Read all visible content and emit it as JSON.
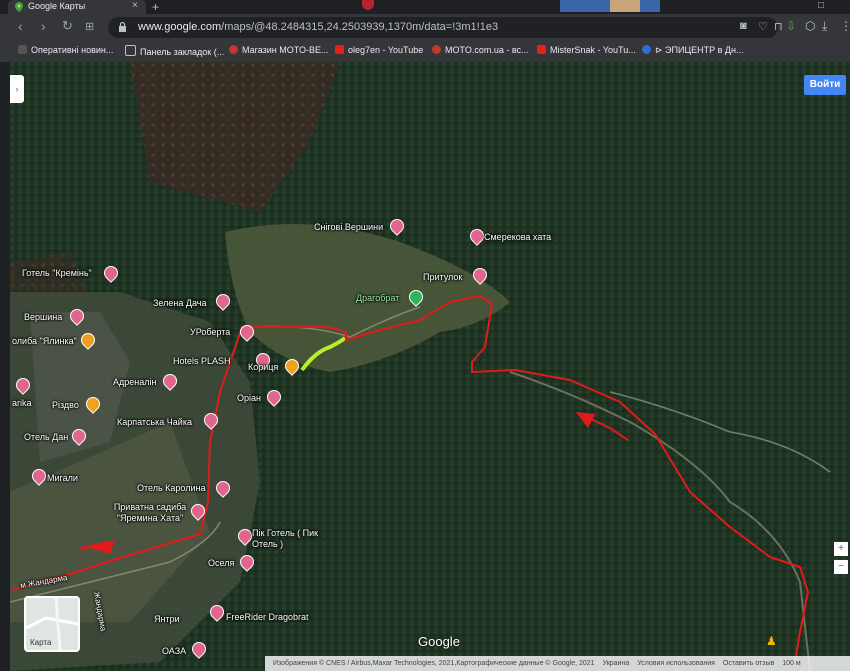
{
  "browser": {
    "tab_title": "Google Карты",
    "tab_close": "×",
    "new_tab": "+",
    "url_host": "www.google.com",
    "url_path": "/maps/@48.2484315,24.2503939,1370m/data=!3m1!1e3"
  },
  "bookmarks": [
    {
      "label": "Оперативні новин...",
      "color": "#555"
    },
    {
      "label": "Панель закладок (...",
      "color": "#777"
    },
    {
      "label": "Магазин MOTO-BE...",
      "color": "#c0392b"
    },
    {
      "label": "oleg7en - YouTube",
      "color": "#e62117"
    },
    {
      "label": "MOTO.com.ua - вс...",
      "color": "#c0392b"
    },
    {
      "label": "MisterSnak - YouTu...",
      "color": "#e62117"
    },
    {
      "label": "⊳ ЭПИЦЕНТР в Дн...",
      "color": "#2f6fd1"
    }
  ],
  "map": {
    "login_button": "Войти",
    "layers_label": "Карта",
    "google_logo": "Google",
    "places": [
      {
        "name": "Снігові Вершини",
        "pin": "pink"
      },
      {
        "name": "Смерекова хата",
        "pin": "pink"
      },
      {
        "name": "Готель \"Кремінь\"",
        "pin": "pink"
      },
      {
        "name": "Притулок",
        "pin": "pink"
      },
      {
        "name": "Драгобрат",
        "pin": "green"
      },
      {
        "name": "Зелена Дача",
        "pin": "pink"
      },
      {
        "name": "Вершина",
        "pin": "pink"
      },
      {
        "name": "УРоберта",
        "pin": "pink"
      },
      {
        "name": "олиба \"Ялинка\"",
        "pin": "orange"
      },
      {
        "name": "Hotels PLASH",
        "pin": "pink"
      },
      {
        "name": "Кориця",
        "pin": "orange"
      },
      {
        "name": "Адреналін",
        "pin": "pink"
      },
      {
        "name": "Оріан",
        "pin": "pink"
      },
      {
        "name": "Різдво",
        "pin": "orange"
      },
      {
        "name": "arika",
        "pin": "pink"
      },
      {
        "name": "Карпатська Чайка",
        "pin": "pink"
      },
      {
        "name": "Отель Дан",
        "pin": "pink"
      },
      {
        "name": "Мигали",
        "pin": "pink"
      },
      {
        "name": "Отель Каролина",
        "pin": "pink"
      },
      {
        "name": "Приватна садиба \"Яремина Хата\"",
        "pin": "pink"
      },
      {
        "name": "Пік Готель ( Пик Отель )",
        "pin": "pink"
      },
      {
        "name": "Оселя",
        "pin": "pink"
      },
      {
        "name": "Янтри",
        "pin": "pink"
      },
      {
        "name": "FreeRider Dragobrat",
        "pin": "pink"
      },
      {
        "name": "ОАЗА",
        "pin": "pink"
      }
    ],
    "road_labels": [
      "м Жандарма",
      "Жандарма"
    ],
    "footer": [
      "Изображения © CNES / Airbus,Maxar Technologies, 2021,Картографические данные © Google, 2021",
      "Украина",
      "Условия использования",
      "Оставить отзыв",
      "100 м"
    ]
  },
  "colors": {
    "route": "#e01b1b",
    "highlight": "#c6ff2a",
    "login": "#4285f4"
  }
}
